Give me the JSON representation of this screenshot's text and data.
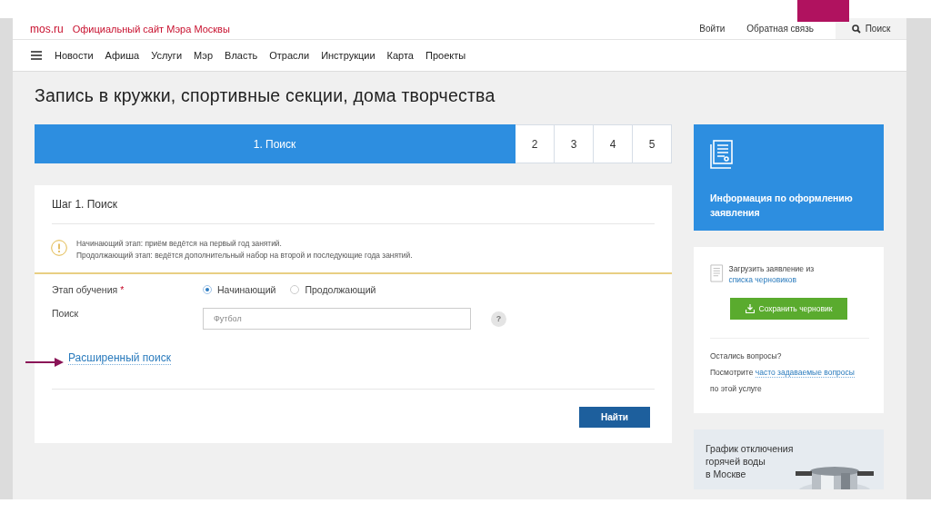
{
  "header": {
    "logo": "mos.ru",
    "tagline": "Официальный сайт Мэра Москвы",
    "links": [
      "Войти",
      "Обратная связь"
    ],
    "search": "Поиск"
  },
  "nav": {
    "items": [
      "Новости",
      "Афиша",
      "Услуги",
      "Мэр",
      "Власть",
      "Отрасли",
      "Инструкции",
      "Карта",
      "Проекты"
    ]
  },
  "title": "Запись в кружки, спортивные секции, дома творчества",
  "steps": [
    {
      "label": "1. Поиск",
      "selected": true
    },
    {
      "label": "2",
      "selected": false
    },
    {
      "label": "3",
      "selected": false
    },
    {
      "label": "4",
      "selected": false
    },
    {
      "label": "5",
      "selected": false
    }
  ],
  "form": {
    "heading": "Шаг 1. Поиск",
    "notice": [
      "Начинающий этап: приём ведётся на первый год занятий.",
      "Продолжающий этап: ведётся дополнительный набор на второй и последующие года занятий."
    ],
    "stage": {
      "label": "Этап обучения",
      "required_mark": "*",
      "options": [
        {
          "label": "Начинающий",
          "selected": true
        },
        {
          "label": "Продолжающий",
          "selected": false
        }
      ]
    },
    "search": {
      "label": "Поиск",
      "placeholder": "Футбол",
      "help": "?"
    },
    "advanced_link": "Расширенный поиск",
    "submit": "Найти"
  },
  "sidebar": {
    "info": "Информация по оформлению заявления",
    "drafts": {
      "text": "Загрузить заявление из ",
      "link": "списка черновиков",
      "button": "Сохранить черновик"
    },
    "faq": {
      "title": "Остались вопросы?",
      "text_before": "Посмотрите ",
      "link": "часто задаваемые вопросы",
      "text_after": " по этой услуге"
    },
    "promo": {
      "lines": [
        "График отключения",
        "горячей воды",
        "в Москве"
      ]
    }
  }
}
